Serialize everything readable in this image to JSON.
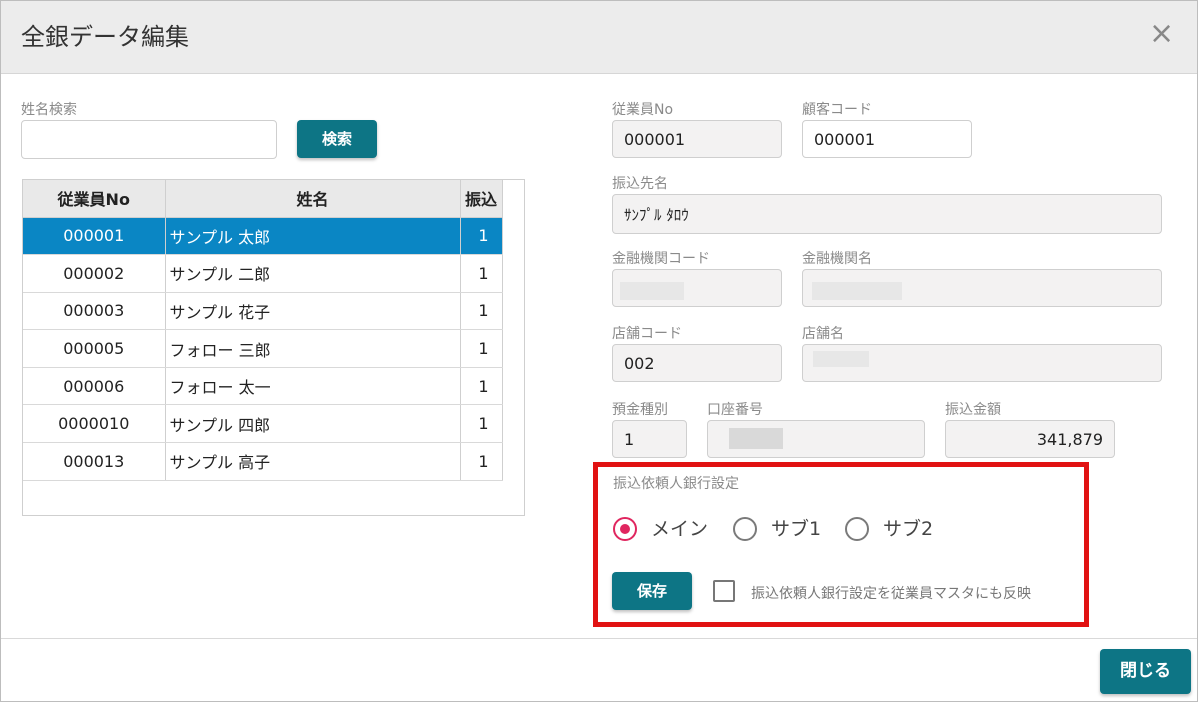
{
  "dialog": {
    "title": "全銀データ編集",
    "close_icon": "×"
  },
  "search": {
    "label": "姓名検索",
    "value": "",
    "placeholder": "",
    "button": "検索"
  },
  "table": {
    "headers": [
      "従業員No",
      "姓名",
      "振込"
    ],
    "rows": [
      {
        "no": "000001",
        "name": "サンプル 太郎",
        "furikomi": "1",
        "selected": true
      },
      {
        "no": "000002",
        "name": "サンプル 二郎",
        "furikomi": "1"
      },
      {
        "no": "000003",
        "name": "サンプル 花子",
        "furikomi": "1"
      },
      {
        "no": "000005",
        "name": "フォロー 三郎",
        "furikomi": "1"
      },
      {
        "no": "000006",
        "name": "フォロー 太一",
        "furikomi": "1"
      },
      {
        "no": "0000010",
        "name": "サンプル 四郎",
        "furikomi": "1"
      },
      {
        "no": "000013",
        "name": "サンプル 高子",
        "furikomi": "1"
      }
    ]
  },
  "form": {
    "employee_no": {
      "label": "従業員No",
      "value": "000001"
    },
    "customer_code": {
      "label": "顧客コード",
      "value": "000001"
    },
    "payee_name": {
      "label": "振込先名",
      "value": "ｻﾝﾌﾟﾙ ﾀﾛｳ"
    },
    "bank_code": {
      "label": "金融機関コード",
      "value": ""
    },
    "bank_name": {
      "label": "金融機関名",
      "value": ""
    },
    "branch_code": {
      "label": "店舗コード",
      "value": "002"
    },
    "branch_name": {
      "label": "店舗名",
      "value": ""
    },
    "deposit_type": {
      "label": "預金種別",
      "value": "1"
    },
    "account_number": {
      "label": "口座番号",
      "value": ""
    },
    "transfer_amount": {
      "label": "振込金額",
      "value": "341,879"
    }
  },
  "requester": {
    "section_label": "振込依頼人銀行設定",
    "options": [
      "メイン",
      "サブ1",
      "サブ2"
    ],
    "selected": "メイン",
    "save_button": "保存",
    "reflect_checkbox_label": "振込依頼人銀行設定を従業員マスタにも反映",
    "reflect_checked": false
  },
  "footer": {
    "close_button": "閉じる"
  },
  "colors": {
    "primary_button": "#0d7585",
    "selected_row": "#0a86c4",
    "radio_checked": "#e0265f",
    "highlight_box": "#e11212"
  }
}
